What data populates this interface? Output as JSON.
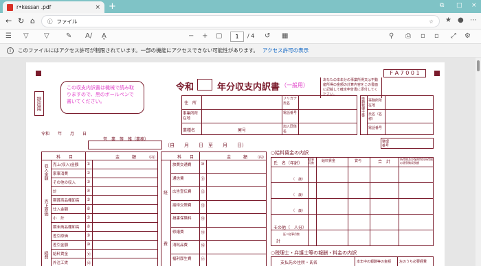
{
  "tab": {
    "title": "r•kessan .pdf",
    "close": "×"
  },
  "newtab": "+",
  "window": {
    "min": "—",
    "max": "□",
    "close": "×",
    "shrink": "⧉"
  },
  "address": {
    "label": "ファイル"
  },
  "toolbar": {
    "page": "1",
    "total": "/ 4"
  },
  "infobar": {
    "message": "このファイルにはアクセス許可が制限されています。一部の機能にアクセスできない可能性があります。",
    "link": "アクセス許可の表示"
  },
  "doc": {
    "form_code": "F A 7 0 0 1",
    "title_pre": "令和",
    "title_post": "年分収支内訳書",
    "title_sub": "（一般用）",
    "notice": "この収支内訳書は機械で読み取りますので、黒のボールペンで書いてください。",
    "side_note": "あなたの本年分の事業所得又は不動産所得の金額の計算内容をこの書面に記載して確定申告書に添付してください。",
    "submit": "提出用",
    "date_label": "令和　　年　　月　　日",
    "business": "営　業　等　雑（業務）",
    "period": "（自　　月　　日　至　　月　　日）",
    "addr_labels": [
      "住　所",
      "事業所所在地",
      "業種名",
      "屋号"
    ],
    "right_labels": [
      "フリガナ氏名",
      "電話番号",
      "加入団体名"
    ],
    "tax_labels": [
      "事務所所在地",
      "氏名（名称）",
      "電話番号"
    ],
    "tax_side": "依頼税理士等",
    "serial": "整理番号",
    "kamoku": "科　　目",
    "kingaku": "金　　　額",
    "en": "（円）",
    "income_side": "収入金額",
    "income_rows": [
      {
        "num": "①",
        "label": "売上(収入)金額"
      },
      {
        "num": "②",
        "label": "家事消費"
      },
      {
        "num": "③",
        "label": "その他の収入"
      },
      {
        "num": "④",
        "label": "計"
      }
    ],
    "cost_side": "売上原価",
    "cost_rows": [
      {
        "num": "⑤",
        "label": "期首商品棚卸高"
      },
      {
        "num": "⑥",
        "label": "仕入金額"
      },
      {
        "num": "⑦",
        "label": "小　計"
      },
      {
        "num": "⑧",
        "label": "期末商品棚卸高"
      },
      {
        "num": "⑨",
        "label": "差引原価"
      },
      {
        "num": "⑩",
        "label": "差引金額"
      }
    ],
    "expense_side": "経費",
    "expense_rows": [
      {
        "num": "⑪",
        "label": "給料賃金"
      },
      {
        "num": "⑫",
        "label": "外注工賃"
      }
    ],
    "mid_side1": "経",
    "mid_side2": "費",
    "mid_rows": [
      {
        "num": "⑩",
        "label": "旅費交通費"
      },
      {
        "num": "⑪",
        "label": "通信費"
      },
      {
        "num": "⑫",
        "label": "広告宣伝費"
      },
      {
        "num": "⑬",
        "label": "接待交際費"
      },
      {
        "num": "⑭",
        "label": "損害保険料"
      },
      {
        "num": "⑮",
        "label": "修繕費"
      },
      {
        "num": "⑯",
        "label": "消耗品費"
      },
      {
        "num": "⑰",
        "label": "福利厚生費"
      }
    ],
    "wage_title": "○給料賃金の内訳",
    "wage_cols": [
      "氏　名（年齢）",
      "従事月数",
      "給料賃金",
      "賞与",
      "合　計",
      "所得税及び復興特別所得税の源泉徴収税額"
    ],
    "age": "（　歳）",
    "wage_other": "その他（　人分）",
    "wage_total": "計",
    "wage_total2": "延べ従事月数",
    "tax_title": "○税理士・弁護士等の報酬・料金の内訳",
    "tax_cols": [
      "支払先の住所・氏名",
      "本年中の報酬等の金額",
      "左のうち必要経費"
    ],
    "yen": "円"
  }
}
